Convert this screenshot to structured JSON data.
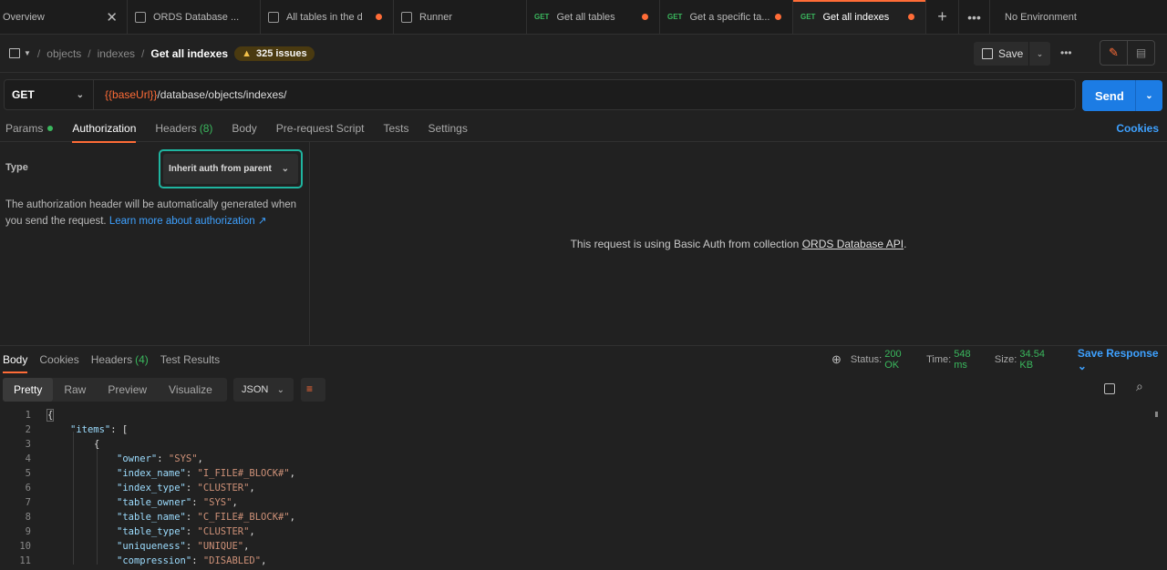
{
  "tabs": [
    {
      "label": "Overview",
      "kind": "overview"
    },
    {
      "label": "ORDS Database ...",
      "kind": "collection"
    },
    {
      "label": "All tables in the d",
      "kind": "folder",
      "dirty": true
    },
    {
      "label": "Runner",
      "kind": "runner"
    },
    {
      "label": "Get all tables",
      "method": "GET",
      "dirty": true
    },
    {
      "label": "Get a specific ta...",
      "method": "GET",
      "dirty": true
    },
    {
      "label": "Get all indexes",
      "method": "GET",
      "dirty": true,
      "active": true
    }
  ],
  "environment": "No Environment",
  "breadcrumb": {
    "items": [
      "objects",
      "indexes"
    ],
    "current": "Get all indexes"
  },
  "issues_label": "325 issues",
  "save_label": "Save",
  "request": {
    "method": "GET",
    "url_var": "{{baseUrl}}",
    "url_path": "/database/objects/indexes/",
    "send_label": "Send"
  },
  "request_tabs": {
    "params": "Params",
    "authorization": "Authorization",
    "headers": "Headers",
    "headers_count": "(8)",
    "body": "Body",
    "prerequest": "Pre-request Script",
    "tests": "Tests",
    "settings": "Settings",
    "cookies": "Cookies"
  },
  "auth": {
    "type_label": "Type",
    "type_value": "Inherit auth from parent",
    "description": "The authorization header will be automatically generated when you send the request.",
    "learn_more": "Learn more about authorization ↗",
    "info_prefix": "This request is using Basic Auth from collection",
    "info_link": "ORDS Database API",
    "info_suffix": "."
  },
  "response_tabs": {
    "body": "Body",
    "cookies": "Cookies",
    "headers": "Headers",
    "headers_count": "(4)",
    "test_results": "Test Results"
  },
  "response_meta": {
    "status_label": "Status:",
    "status_value": "200 OK",
    "time_label": "Time:",
    "time_value": "548 ms",
    "size_label": "Size:",
    "size_value": "34.54 KB",
    "save_response": "Save Response"
  },
  "view_modes": [
    "Pretty",
    "Raw",
    "Preview",
    "Visualize"
  ],
  "format": "JSON",
  "code_lines": [
    {
      "n": "1",
      "text": "{"
    },
    {
      "n": "2",
      "key": "\"items\"",
      "rest": ": ["
    },
    {
      "n": "3",
      "text": "{"
    },
    {
      "n": "4",
      "key": "\"owner\"",
      "val": "\"SYS\"",
      "comma": ","
    },
    {
      "n": "5",
      "key": "\"index_name\"",
      "val": "\"I_FILE#_BLOCK#\"",
      "comma": ","
    },
    {
      "n": "6",
      "key": "\"index_type\"",
      "val": "\"CLUSTER\"",
      "comma": ","
    },
    {
      "n": "7",
      "key": "\"table_owner\"",
      "val": "\"SYS\"",
      "comma": ","
    },
    {
      "n": "8",
      "key": "\"table_name\"",
      "val": "\"C_FILE#_BLOCK#\"",
      "comma": ","
    },
    {
      "n": "9",
      "key": "\"table_type\"",
      "val": "\"CLUSTER\"",
      "comma": ","
    },
    {
      "n": "10",
      "key": "\"uniqueness\"",
      "val": "\"UNIQUE\"",
      "comma": ","
    },
    {
      "n": "11",
      "key": "\"compression\"",
      "val": "\"DISABLED\"",
      "comma": ","
    }
  ]
}
